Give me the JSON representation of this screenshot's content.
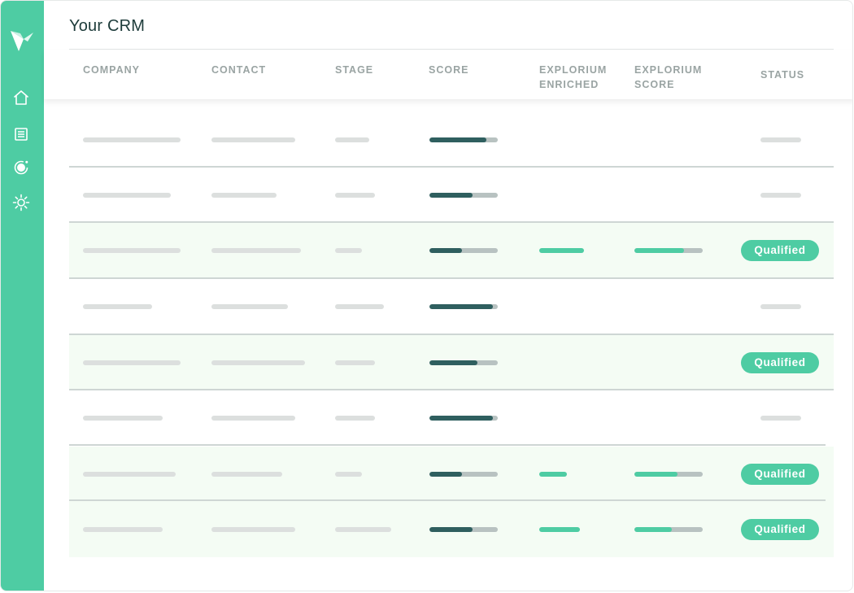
{
  "app": {
    "title": "Your CRM"
  },
  "colors": {
    "accent": "#4ecca3",
    "score_fill": "#2f5f5f",
    "track": "#b8c2c1",
    "placeholder": "#dcdfde",
    "row_highlight": "#f4fcf4",
    "title": "#1d3b3a",
    "header_text": "#9aa4a3"
  },
  "sidebar": {
    "items": [
      {
        "name": "logo-icon"
      },
      {
        "name": "home-icon"
      },
      {
        "name": "document-list-icon"
      },
      {
        "name": "target-icon"
      },
      {
        "name": "settings-icon"
      }
    ]
  },
  "table": {
    "columns": [
      "COMPANY",
      "CONTACT",
      "STAGE",
      "SCORE",
      "EXPLORIUM ENRICHED",
      "EXPLORIUM SCORE",
      "STATUS"
    ],
    "rows": [
      {
        "highlighted": false,
        "score": 0.83,
        "enriched": null,
        "explorium_score": null,
        "status": null
      },
      {
        "highlighted": false,
        "score": 0.63,
        "enriched": null,
        "explorium_score": null,
        "status": null
      },
      {
        "highlighted": true,
        "score": 0.48,
        "enriched": 0.65,
        "explorium_score": 0.73,
        "status": "Qualified"
      },
      {
        "highlighted": false,
        "score": 0.93,
        "enriched": null,
        "explorium_score": null,
        "status": null
      },
      {
        "highlighted": true,
        "score": 0.7,
        "enriched": null,
        "explorium_score": null,
        "status": "Qualified"
      },
      {
        "highlighted": false,
        "score": 0.93,
        "enriched": null,
        "explorium_score": null,
        "status": null
      },
      {
        "highlighted": true,
        "score": 0.48,
        "enriched": 0.4,
        "explorium_score": 0.63,
        "status": "Qualified"
      },
      {
        "highlighted": true,
        "score": 0.63,
        "enriched": 0.59,
        "explorium_score": 0.55,
        "status": "Qualified"
      }
    ]
  }
}
